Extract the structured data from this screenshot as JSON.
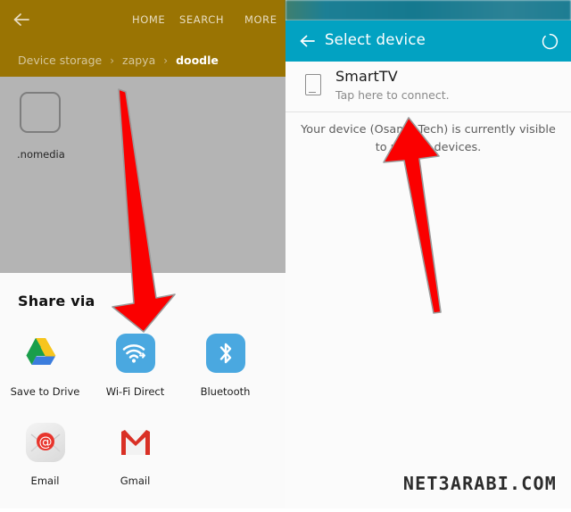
{
  "colors": {
    "file_manager_header": "#9a7403",
    "file_area_background": "#b4b4b4",
    "select_device_header": "#02a2c2",
    "status_bar": "#1c7f95",
    "arrow_red": "#fb0000",
    "app_tile_blue": "#4aa8e0",
    "gmail_red": "#d93025"
  },
  "file_manager": {
    "back_icon": "arrow-left-icon",
    "actions": [
      {
        "label": "HOME"
      },
      {
        "label": "SEARCH"
      },
      {
        "label": "MORE"
      }
    ],
    "breadcrumb": {
      "separator": "›",
      "items": [
        {
          "label": "Device storage",
          "current": false
        },
        {
          "label": "zapya",
          "current": false
        },
        {
          "label": "doodle",
          "current": true
        }
      ]
    },
    "files": [
      {
        "name": ".nomedia",
        "icon": "file-blank-icon"
      }
    ]
  },
  "share_sheet": {
    "title": "Share via",
    "rows": [
      [
        {
          "label": "Save to Drive",
          "icon": "google-drive-icon"
        },
        {
          "label": "Wi-Fi Direct",
          "icon": "wifi-direct-icon"
        },
        {
          "label": "Bluetooth",
          "icon": "bluetooth-icon"
        }
      ],
      [
        {
          "label": "Email",
          "icon": "email-at-icon"
        },
        {
          "label": "Gmail",
          "icon": "gmail-icon"
        }
      ]
    ]
  },
  "select_device": {
    "back_icon": "arrow-left-icon",
    "title": "Select device",
    "scan_icon": "scanning-circle-icon",
    "devices": [
      {
        "name": "SmartTV",
        "subtitle": "Tap here to connect.",
        "icon": "tablet-device-icon"
      }
    ],
    "visibility_note": "Your device (Osama Tech) is currently visible to nearby devices."
  },
  "annotations": [
    {
      "name": "arrow-down-to-wifi-direct",
      "direction": "down",
      "color": "#fb0000"
    },
    {
      "name": "arrow-up-to-smarttv",
      "direction": "up",
      "color": "#fb0000"
    }
  ],
  "watermark": {
    "text": "NET3ARABI.COM"
  }
}
